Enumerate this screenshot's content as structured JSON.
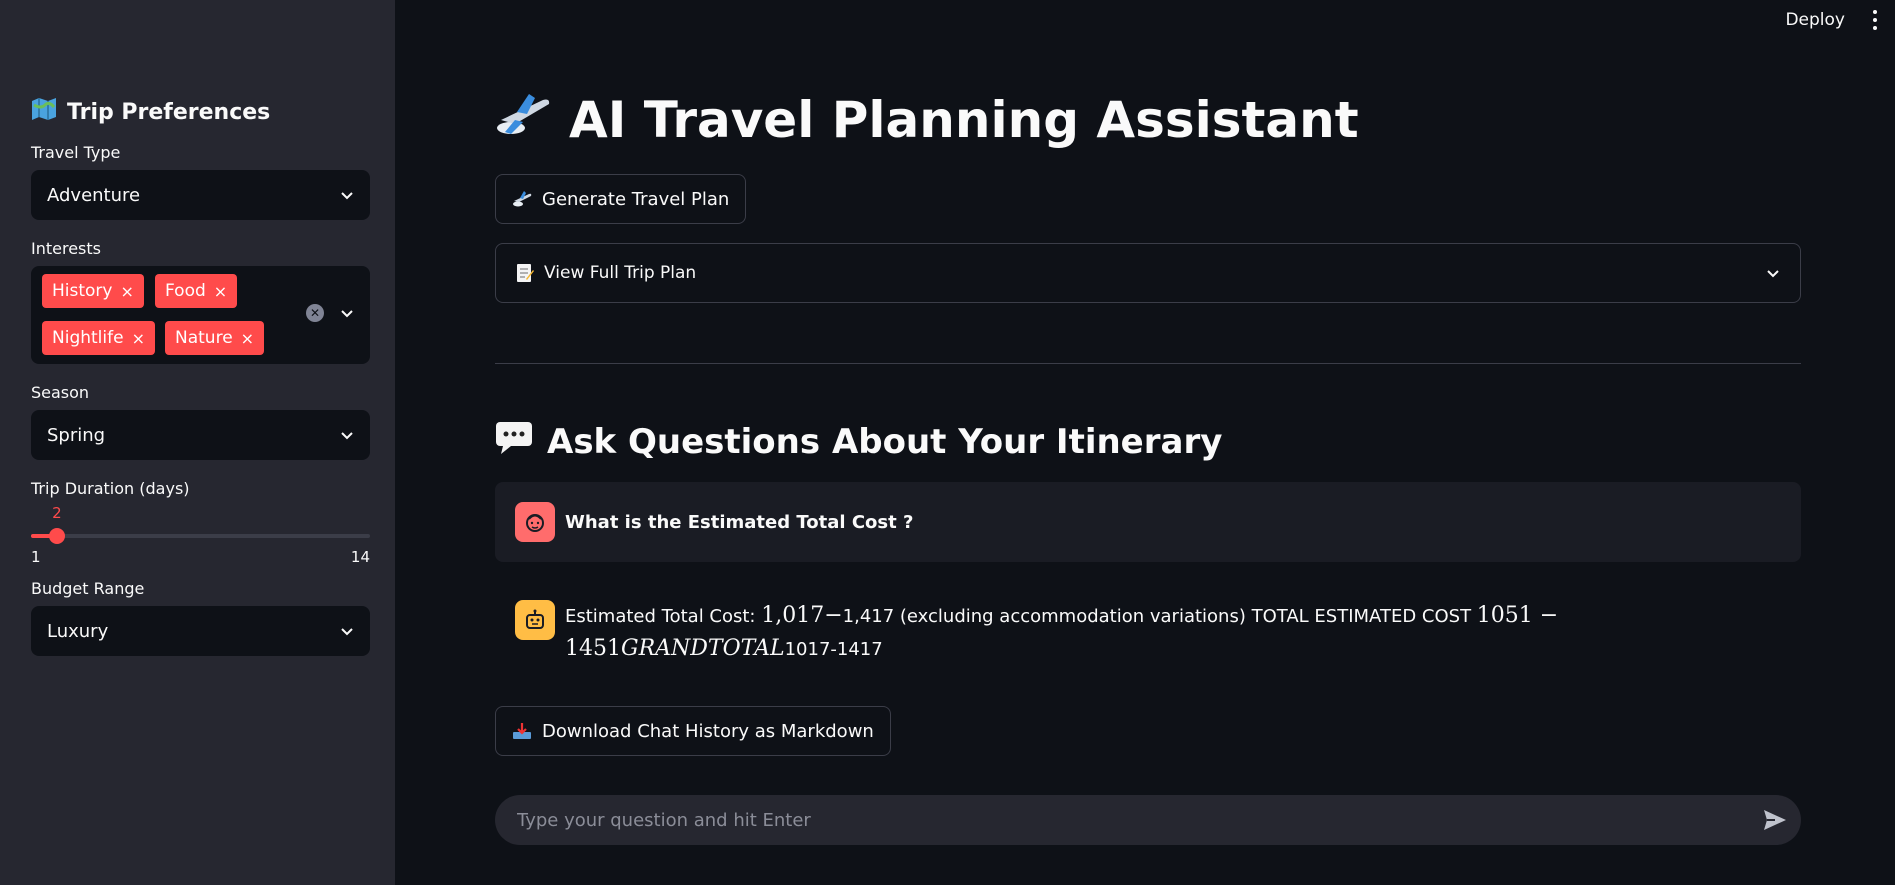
{
  "header": {
    "deploy_label": "Deploy",
    "menu_icon": "vertical-dots-icon"
  },
  "sidebar": {
    "title": "Trip Preferences",
    "title_icon": "map-icon",
    "travel_type": {
      "label": "Travel Type",
      "value": "Adventure"
    },
    "interests": {
      "label": "Interests",
      "tags": [
        "History",
        "Food",
        "Nightlife",
        "Nature"
      ],
      "remove_glyph": "×"
    },
    "season": {
      "label": "Season",
      "value": "Spring"
    },
    "duration": {
      "label": "Trip Duration (days)",
      "value": "2",
      "min": "1",
      "max": "14"
    },
    "budget": {
      "label": "Budget Range",
      "value": "Luxury"
    }
  },
  "main": {
    "title": "AI Travel Planning Assistant",
    "title_icon": "airplane-icon",
    "generate_button": "Generate Travel Plan",
    "expander_label": "View Full Trip Plan",
    "expander_icon": "memo-icon",
    "chat_heading": "Ask Questions About Your Itinerary",
    "chat_heading_icon": "speech-bubble-icon",
    "user_message": "What is the Estimated Total Cost ?",
    "bot_message": {
      "prefix": "Estimated Total Cost: ",
      "math1": "1,017−",
      "part2": "1,417 (excluding accommodation variations) TOTAL ESTIMATED COST ",
      "math2": "1051 − 1451",
      "math3": "GRANDTOTAL",
      "suffix": "1017-1417"
    },
    "download_button": "Download Chat History as Markdown",
    "chat_placeholder": "Type your question and hit Enter"
  },
  "colors": {
    "accent": "#ff4b4b",
    "sidebar_bg": "#262730",
    "main_bg": "#0e1117",
    "bot_avatar": "#ffbd45",
    "user_avatar": "#ff6c6c"
  }
}
